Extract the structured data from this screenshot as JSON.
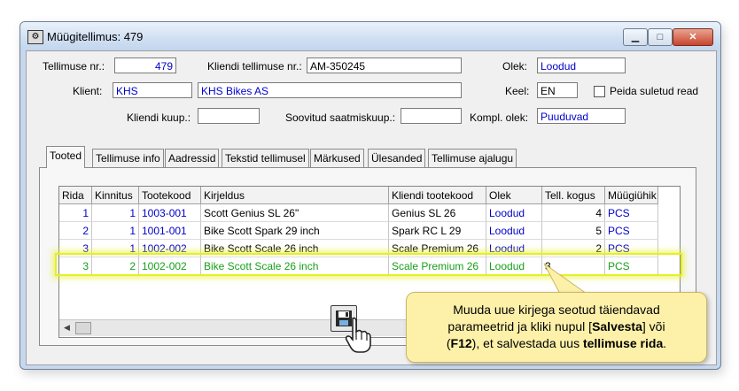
{
  "window": {
    "title": "Müügitellimus: 479",
    "icon": "gear-icon",
    "buttons": {
      "minimize": "▁",
      "maximize": "□",
      "close": "✕"
    }
  },
  "form": {
    "order_nr_label": "Tellimuse nr.:",
    "order_nr": "479",
    "client_order_label": "Kliendi tellimuse nr.:",
    "client_order": "AM-350245",
    "state_label": "Olek:",
    "state": "Loodud",
    "client_label": "Klient:",
    "client_code": "KHS",
    "client_name": "KHS Bikes AS",
    "lang_label": "Keel:",
    "lang": "EN",
    "hide_closed_label": "Peida suletud read",
    "client_buy_label": "Kliendi kuup.:",
    "client_buy": "",
    "desired_ship_label": "Soovitud saatmiskuup.:",
    "desired_ship": "",
    "compl_state_label": "Kompl. olek:",
    "compl_state": "Puuduvad"
  },
  "tabs": [
    {
      "label": "Tooted"
    },
    {
      "label": "Tellimuse info"
    },
    {
      "label": "Aadressid"
    },
    {
      "label": "Tekstid tellimusel"
    },
    {
      "label": "Märkused"
    },
    {
      "label": "Ülesanded"
    },
    {
      "label": "Tellimuse ajalugu"
    }
  ],
  "table": {
    "headers": [
      "Rida",
      "Kinnitus",
      "Tootekood",
      "Kirjeldus",
      "Kliendi tootekood",
      "Olek",
      "Tell. kogus",
      "Müügiühik"
    ],
    "rows": [
      [
        "1",
        "1",
        "1003-001",
        "Scott Genius SL 26\"",
        "Genius SL 26",
        "Loodud",
        "4",
        "PCS"
      ],
      [
        "2",
        "1",
        "1001-001",
        "Bike Scott Spark 29 inch",
        "Spark RC L 29",
        "Loodud",
        "5",
        "PCS"
      ],
      [
        "3",
        "1",
        "1002-002",
        "Bike Scott Scale 26 inch",
        "Scale Premium 26",
        "Loodud",
        "2",
        "PCS"
      ],
      [
        "3",
        "2",
        "1002-002",
        "Bike Scott Scale 26 inch",
        "Scale Premium 26",
        "Loodud",
        "3",
        "PCS"
      ]
    ]
  },
  "callout": {
    "line1": "Muuda uue kirjega seotud täiendavad",
    "line2_a": "parameetrid ja kliki nupul [",
    "line2_b": "Salvesta",
    "line2_c": "] või",
    "line3_a": "(",
    "line3_b": "F12",
    "line3_c": "), et salvestada uus ",
    "line3_d": "tellimuse rida",
    "line3_e": "."
  },
  "colors": {
    "highlight": "#e5f020",
    "value_blue": "#0000cc",
    "new_row_green": "#17a01a",
    "callout_bg": "#fdf1a9"
  }
}
